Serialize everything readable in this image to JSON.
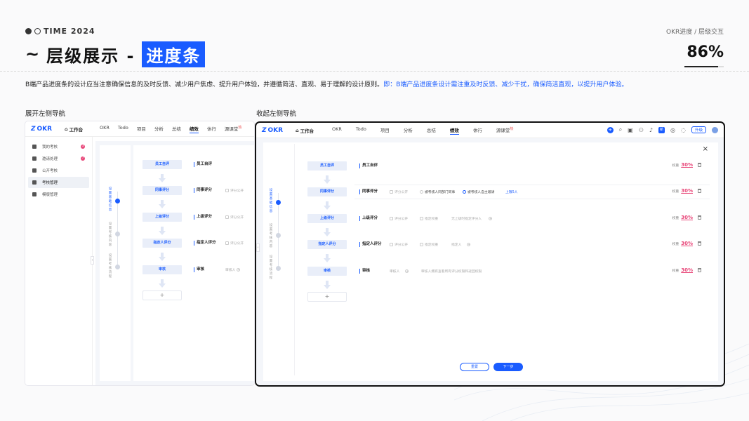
{
  "header": {
    "brand": "TIME 2024",
    "breadcrumb": "OKR进度 / 层级交互",
    "tilde": "~",
    "title_main": "层级展示 -",
    "title_highlight": "进度条",
    "progress": {
      "label": "86%",
      "value": 0.86
    }
  },
  "description": {
    "plain": "B端产品进度条的设计应当注意确保信息的及时反馈、减少用户焦虑、提升用户体验，并遵循简洁、直观、易于理解的设计原则。",
    "highlight": "即：B端产品进度条设计需注重及时反馈、减少干扰，确保简洁直观，以提升用户体验。"
  },
  "sections": {
    "expanded_label": "展开左侧导航",
    "collapsed_label": "收起左侧导航"
  },
  "app": {
    "logo": "OKR",
    "workbench": "工作台",
    "nav": [
      "OKR",
      "Todo",
      "项目",
      "分析",
      "总结",
      "绩效",
      "休行",
      "源课堂"
    ],
    "nav_active": "绩效",
    "hot_badge": "热",
    "upgrade": "升级",
    "mini_label": "新"
  },
  "sidebar": {
    "items": [
      {
        "label": "我的考核",
        "badge": "3"
      },
      {
        "label": "邀请处理",
        "badge": "7"
      },
      {
        "label": "公开考核",
        "badge": ""
      },
      {
        "label": "考核管理",
        "badge": ""
      },
      {
        "label": "模版管理",
        "badge": ""
      }
    ],
    "active_index": 3
  },
  "steps": [
    {
      "label": "设置基础信息",
      "active": true
    },
    {
      "label": "设置考核内容",
      "active": false
    },
    {
      "label": "设置考核流程",
      "active": false
    }
  ],
  "flow": {
    "nodes": [
      "员工自评",
      "同事评分",
      "上级评分",
      "指定人评分",
      "审核"
    ],
    "add_label": "+"
  },
  "rows": [
    {
      "label": "员工自评",
      "weight_label": "权重",
      "weight_value": "30%"
    },
    {
      "label": "同事评分",
      "public": "评分公开",
      "opt1": "被考核人同部门同事",
      "opt2": "被考核人自主邀请",
      "limit": "上限5人",
      "weight_label": "权重",
      "weight_value": "30%"
    },
    {
      "label": "上级评分",
      "public": "评分公开",
      "opt1": "指定权重",
      "opt2": "无上级时指定评分人",
      "weight_label": "权重",
      "weight_value": "30%"
    },
    {
      "label": "指定人评分",
      "public": "评分公开",
      "opt1": "指定权重",
      "opt2": "指定人",
      "weight_label": "权重",
      "weight_value": "30%"
    },
    {
      "label": "审核",
      "reviewer": "审核人",
      "note": "审核人拥有查看所有评分权限和返回权限",
      "weight_label": "权重",
      "weight_value": "30%"
    }
  ],
  "buttons": {
    "reset": "重置",
    "next": "下一步"
  },
  "close_icon": "×",
  "collapse_icon": "‹",
  "colors": {
    "accent": "#1a5cff",
    "weight": "#e8487a",
    "border_highlight": "#111111"
  }
}
